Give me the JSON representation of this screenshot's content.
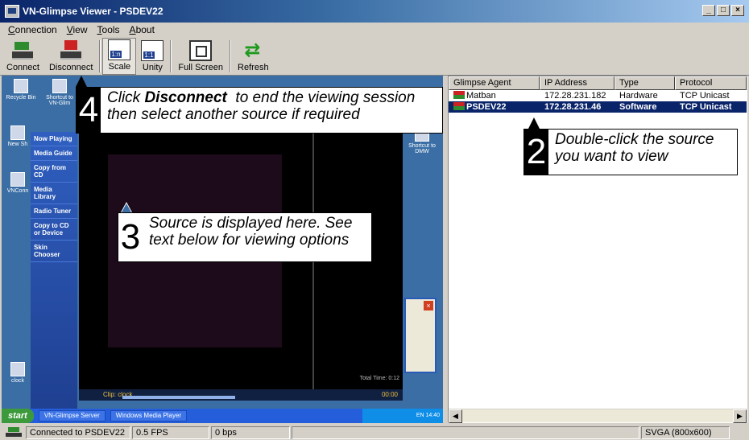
{
  "window": {
    "title": "VN-Glimpse Viewer - PSDEV22"
  },
  "menu": [
    "Connection",
    "View",
    "Tools",
    "About"
  ],
  "toolbar": {
    "connect": "Connect",
    "disconnect": "Disconnect",
    "scale": "Scale",
    "unity": "Unity",
    "full_screen": "Full Screen",
    "refresh": "Refresh"
  },
  "remote_desktop": {
    "icons": [
      "Recycle Bin",
      "Shortcut to VN-Glim",
      "New Sh",
      "VNConn",
      "Shortcut to DMW",
      "clock"
    ],
    "wmp_menu": [
      "Now Playing",
      "Media Guide",
      "Copy from CD",
      "Media Library",
      "Radio Tuner",
      "Copy to CD or Device",
      "Skin Chooser"
    ],
    "clip_label": "Clip: clock",
    "clip_time": "00:00",
    "total_time": "Total Time: 0:12",
    "taskbar": {
      "start": "start",
      "items": [
        "VN-Glimpse Server",
        "Windows Media Player"
      ],
      "tray": "EN 14:40"
    }
  },
  "agent_list": {
    "columns": [
      "Glimpse Agent",
      "IP Address",
      "Type",
      "Protocol"
    ],
    "rows": [
      {
        "agent": "Matban",
        "ip": "172.28.231.182",
        "type": "Hardware",
        "protocol": "TCP Unicast",
        "selected": false
      },
      {
        "agent": "PSDEV22",
        "ip": "172.28.231.46",
        "type": "Software",
        "protocol": "TCP Unicast",
        "selected": true
      }
    ]
  },
  "callouts": {
    "c4": {
      "num": "4",
      "line1_pre": "Click ",
      "line1_bold": "Disconnect",
      "line1_post": "  to end the viewing session",
      "line2": "then select another source if required"
    },
    "c2": {
      "num": "2",
      "line1": "Double-click the source",
      "line2": "you want to view"
    },
    "c3": {
      "num": "3",
      "line1": "Source is displayed here. See",
      "line2": "text below for viewing options"
    }
  },
  "statusbar": {
    "connected": "Connected to PSDEV22",
    "fps": "0.5 FPS",
    "bps": "0 bps",
    "resolution": "SVGA (800x600)"
  }
}
